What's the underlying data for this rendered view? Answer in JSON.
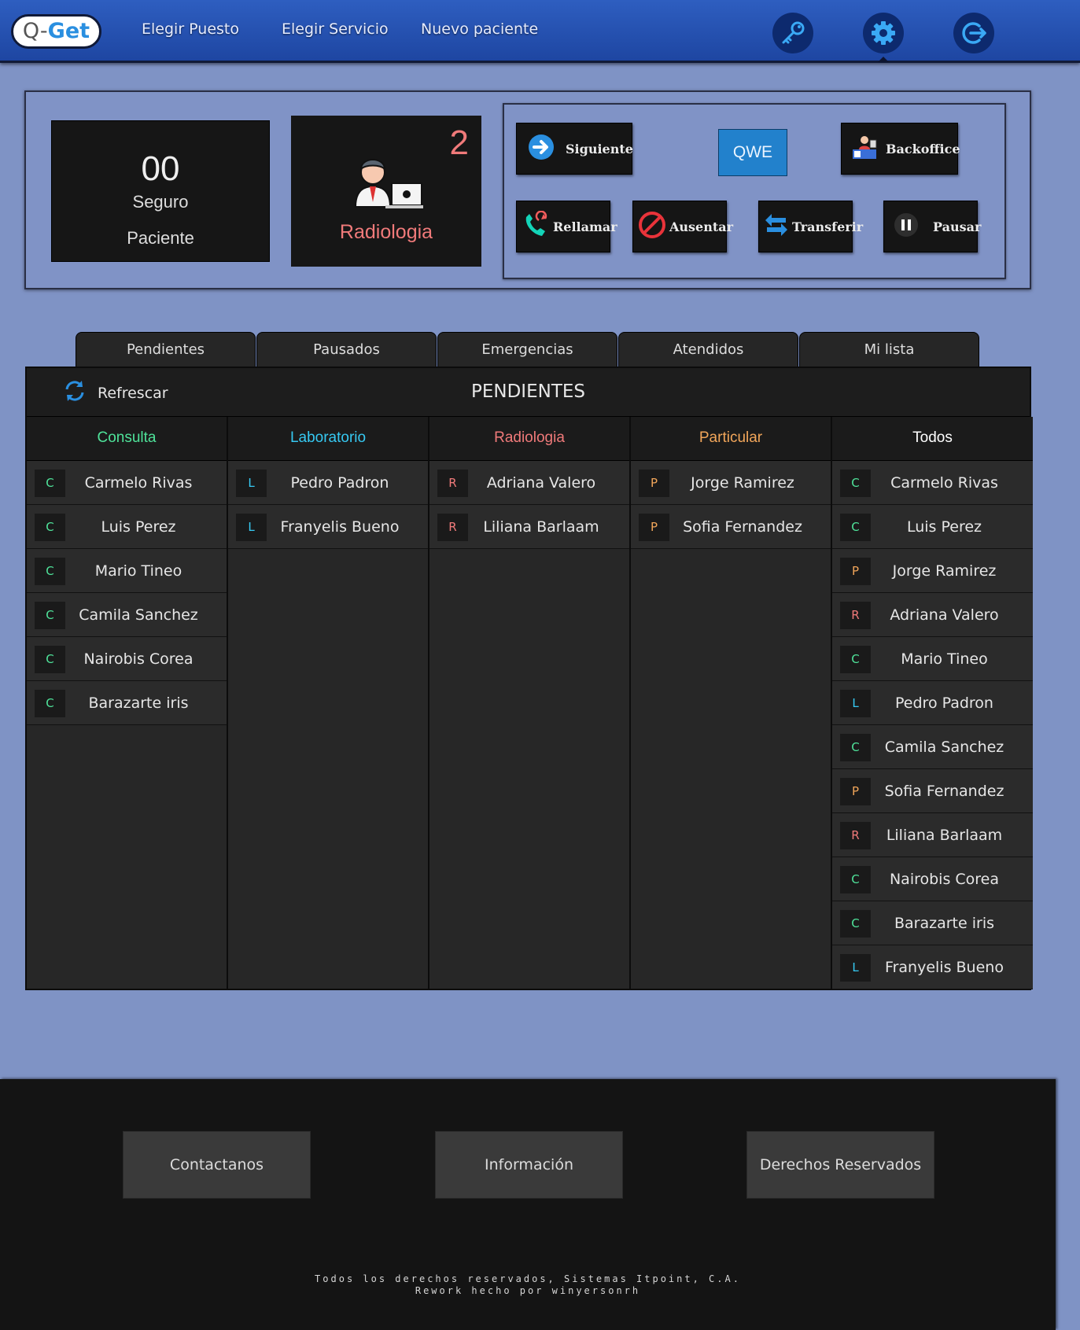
{
  "header": {
    "logo_q": "Q-",
    "logo_get": "Get",
    "nav": [
      "Elegir Puesto",
      "Elegir Servicio",
      "Nuevo paciente"
    ],
    "icons": [
      "key-icon",
      "gear-icon",
      "logout-icon"
    ]
  },
  "ticket": {
    "number": "00",
    "type": "Seguro",
    "label": "Paciente"
  },
  "service": {
    "count": "2",
    "name": "Radiologia"
  },
  "actions": {
    "siguiente": "Siguiente",
    "qwe": "QWE",
    "backoffice": "Backoffice",
    "rellamar": "Rellamar",
    "ausentar": "Ausentar",
    "transferir": "Transferir",
    "pausar": "Pausar"
  },
  "tabs": [
    "Pendientes",
    "Pausados",
    "Emergencias",
    "Atendidos",
    "Mi lista"
  ],
  "board": {
    "refresh_label": "Refrescar",
    "title": "PENDIENTES",
    "columns": [
      {
        "title": "Consulta",
        "color": "#4fe39a"
      },
      {
        "title": "Laboratorio",
        "color": "#36c9f2"
      },
      {
        "title": "Radiologia",
        "color": "#f07a7a"
      },
      {
        "title": "Particular",
        "color": "#f2a65a"
      },
      {
        "title": "Todos",
        "color": "#ffffff"
      }
    ],
    "consulta": [
      {
        "code": "C",
        "name": "Carmelo Rivas"
      },
      {
        "code": "C",
        "name": "Luis Perez"
      },
      {
        "code": "C",
        "name": "Mario Tineo"
      },
      {
        "code": "C",
        "name": "Camila Sanchez"
      },
      {
        "code": "C",
        "name": "Nairobis Corea"
      },
      {
        "code": "C",
        "name": "Barazarte iris"
      }
    ],
    "laboratorio": [
      {
        "code": "L",
        "name": "Pedro Padron"
      },
      {
        "code": "L",
        "name": "Franyelis Bueno"
      }
    ],
    "radiologia": [
      {
        "code": "R",
        "name": "Adriana Valero"
      },
      {
        "code": "R",
        "name": "Liliana Barlaam"
      }
    ],
    "particular": [
      {
        "code": "P",
        "name": "Jorge Ramirez"
      },
      {
        "code": "P",
        "name": "Sofia Fernandez"
      }
    ],
    "todos": [
      {
        "code": "C",
        "name": "Carmelo Rivas"
      },
      {
        "code": "C",
        "name": "Luis Perez"
      },
      {
        "code": "P",
        "name": "Jorge Ramirez"
      },
      {
        "code": "R",
        "name": "Adriana Valero"
      },
      {
        "code": "C",
        "name": "Mario Tineo"
      },
      {
        "code": "L",
        "name": "Pedro Padron"
      },
      {
        "code": "C",
        "name": "Camila Sanchez"
      },
      {
        "code": "P",
        "name": "Sofia Fernandez"
      },
      {
        "code": "R",
        "name": "Liliana Barlaam"
      },
      {
        "code": "C",
        "name": "Nairobis Corea"
      },
      {
        "code": "C",
        "name": "Barazarte iris"
      },
      {
        "code": "L",
        "name": "Franyelis Bueno"
      }
    ]
  },
  "code_colors": {
    "C": "#4fe39a",
    "L": "#36c9f2",
    "R": "#f07a7a",
    "P": "#f2a65a"
  },
  "footer": {
    "buttons": [
      "Contactanos",
      "Información",
      "Derechos Reservados"
    ],
    "legal_1": "Todos los derechos reservados, Sistemas Itpoint, C.A.",
    "legal_2": "Rework hecho por winyersonrh"
  }
}
